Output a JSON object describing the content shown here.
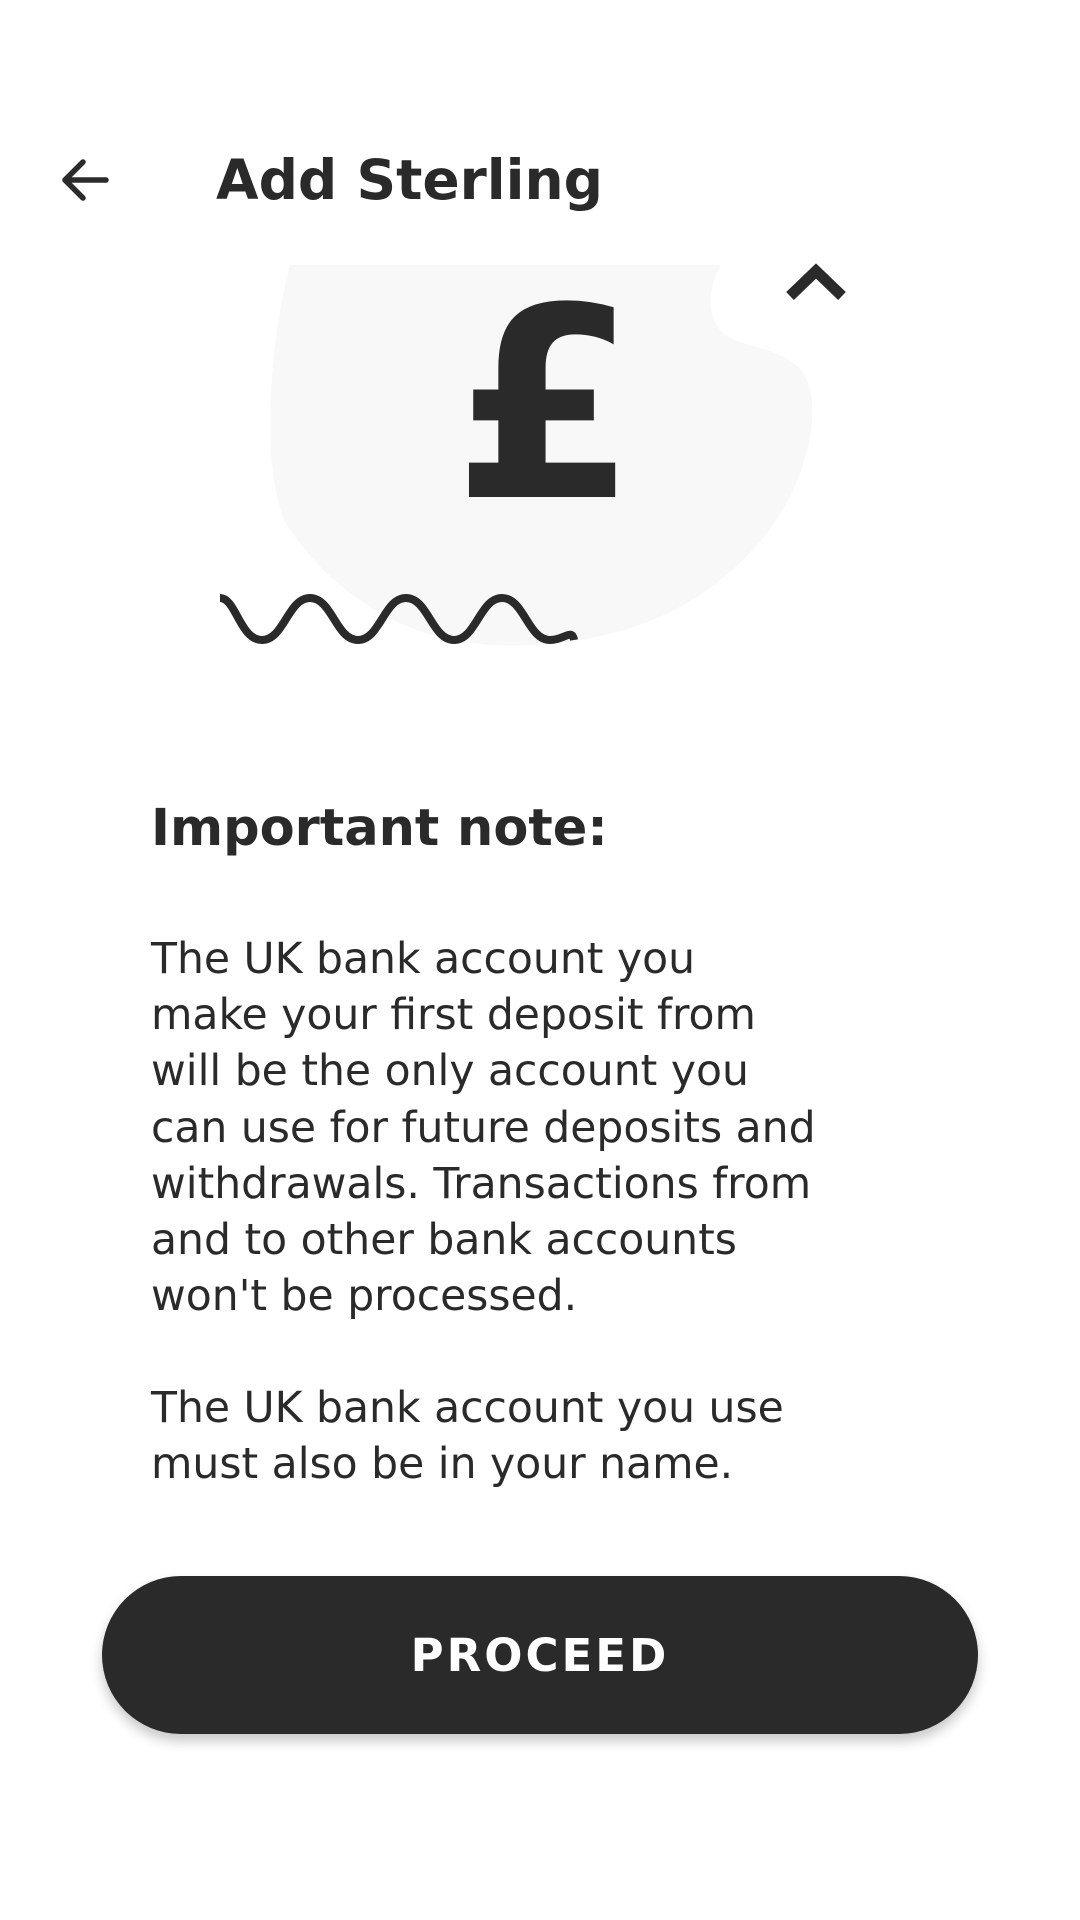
{
  "header": {
    "title": "Add Sterling",
    "back_icon": "arrow-left-icon"
  },
  "illustration": {
    "currency_symbol": "£",
    "blob_color": "#f8f8f8",
    "ink_color": "#2a2a2a"
  },
  "note": {
    "heading": "Important note:",
    "paragraph1": "The UK bank account you\nmake your first deposit from\nwill be the only account you\ncan use for future deposits and\nwithdrawals. Transactions from\nand to other bank accounts\nwon't be processed.",
    "paragraph2": "The UK bank account you use\nmust also be in your name."
  },
  "actions": {
    "proceed_label": "PROCEED"
  },
  "colors": {
    "primary": "#2a2a2a",
    "background": "#ffffff"
  }
}
